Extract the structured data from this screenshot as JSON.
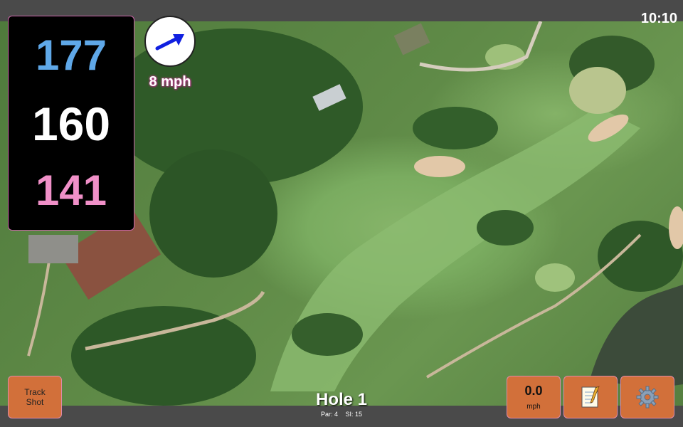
{
  "status": {
    "time": "10:10"
  },
  "yardage": {
    "back": "177",
    "middle": "160",
    "front": "141"
  },
  "wind": {
    "speed_label": "8 mph",
    "icon": "wind-direction-arrow-icon"
  },
  "buttons": {
    "track_line1": "Track",
    "track_line2": "Shot",
    "speed_value": "0.0",
    "speed_unit": "mph",
    "notes_icon": "notepad-icon",
    "settings_icon": "gear-icon"
  },
  "hole": {
    "title": "Hole 1",
    "par": "Par: 4",
    "si": "SI: 15"
  },
  "colors": {
    "back_yardage": "#5fa8e8",
    "middle_yardage": "#ffffff",
    "front_yardage": "#f090c8",
    "button_bg": "#d2703a",
    "bar_bg": "#4a4a4a"
  }
}
